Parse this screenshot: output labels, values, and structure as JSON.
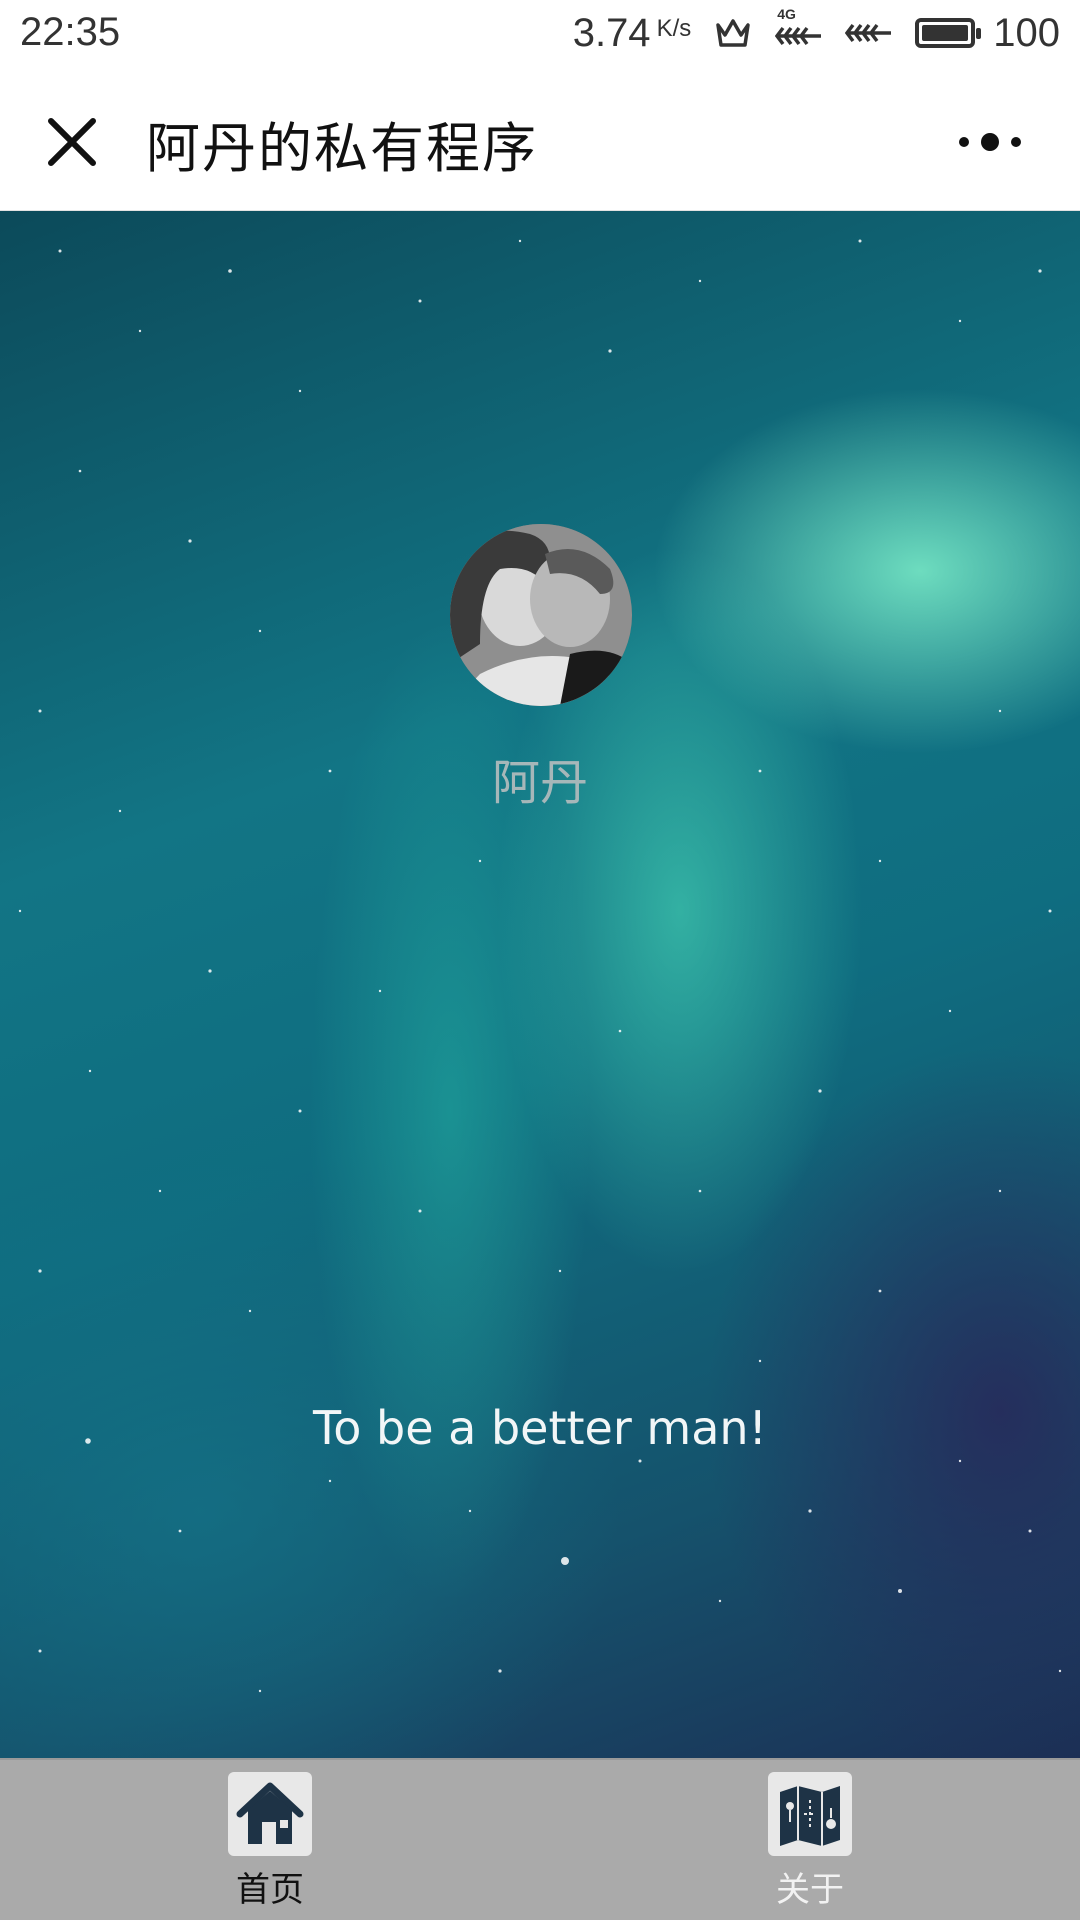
{
  "status_bar": {
    "time": "22:35",
    "net_speed": "3.74",
    "net_speed_unit": "K/s",
    "network_label": "4G",
    "battery": "100"
  },
  "nav": {
    "title": "阿丹的私有程序"
  },
  "profile": {
    "name": "阿丹",
    "motto": "To be a better man!"
  },
  "tabs": [
    {
      "label": "首页",
      "icon": "home-icon",
      "active": true
    },
    {
      "label": "关于",
      "icon": "map-icon",
      "active": false
    }
  ],
  "colors": {
    "nav_background": "#ffffff",
    "tab_bar_background": "#aaaaaa",
    "icon_dark": "#1e3346",
    "aurora_green": "#8cffd2"
  }
}
